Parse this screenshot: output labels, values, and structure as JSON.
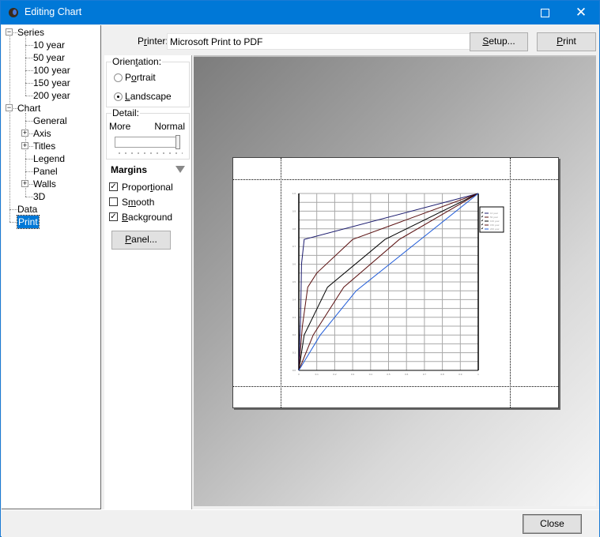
{
  "window": {
    "title": "Editing Chart",
    "minimize_icon": "minimize-icon",
    "maximize_icon": "maximize-icon",
    "close_icon": "close-icon"
  },
  "tree": {
    "expand_glyph": "+",
    "collapse_glyph": "−",
    "nodes": [
      {
        "label": "Series",
        "level": 0,
        "expander": "collapse"
      },
      {
        "label": "10 year",
        "level": 1
      },
      {
        "label": "50 year",
        "level": 1
      },
      {
        "label": "100 year",
        "level": 1
      },
      {
        "label": "150 year",
        "level": 1
      },
      {
        "label": "200 year",
        "level": 1
      },
      {
        "label": "Chart",
        "level": 0,
        "expander": "collapse"
      },
      {
        "label": "General",
        "level": 1
      },
      {
        "label": "Axis",
        "level": 1,
        "expander": "expand"
      },
      {
        "label": "Titles",
        "level": 1,
        "expander": "expand"
      },
      {
        "label": "Legend",
        "level": 1
      },
      {
        "label": "Panel",
        "level": 1
      },
      {
        "label": "Walls",
        "level": 1,
        "expander": "expand"
      },
      {
        "label": "3D",
        "level": 1
      },
      {
        "label": "Data",
        "level": 0
      },
      {
        "label": "Print",
        "level": 0,
        "selected": true
      }
    ]
  },
  "printer": {
    "label_pre": "P",
    "label_ul": "r",
    "label_post": "inter:",
    "value": "Microsoft Print to PDF",
    "setup_ul": "S",
    "setup_rest": "etup...",
    "print_ul": "P",
    "print_rest": "rint"
  },
  "orientation": {
    "label_pre": "Orien",
    "label_ul": "t",
    "label_post": "ation:",
    "portrait_pre": "P",
    "portrait_ul": "o",
    "portrait_post": "rtrait",
    "landscape_ul": "L",
    "landscape_post": "andscape",
    "selected": "Landscape"
  },
  "detail": {
    "label": "Detail:",
    "more_label": "More",
    "normal_label": "Normal",
    "slider_value": 1.0
  },
  "margins": {
    "label": "Margins",
    "proportional_pre": "Propor",
    "proportional_ul": "t",
    "proportional_post": "ional",
    "proportional_checked": true,
    "smooth_pre": "S",
    "smooth_ul": "m",
    "smooth_post": "ooth",
    "smooth_checked": false,
    "background_ul": "B",
    "background_post": "ackground",
    "background_checked": true,
    "panel_ul": "P",
    "panel_rest": "anel...",
    "check_glyph": "✓"
  },
  "footer": {
    "close_label": "Close"
  },
  "chart_data": {
    "type": "line",
    "title": "",
    "xlabel": "",
    "ylabel": "",
    "xlim": [
      0,
      1
    ],
    "ylim": [
      0,
      1
    ],
    "x_ticks": [
      0,
      0.1,
      0.2,
      0.3,
      0.4,
      0.5,
      0.6,
      0.7,
      0.8,
      0.9,
      1
    ],
    "y_gridlines": 20,
    "grid": true,
    "legend_position": "right",
    "legend_title": "",
    "series": [
      {
        "name": "10 year",
        "color": "#1b1b6e",
        "points": [
          [
            0,
            0
          ],
          [
            0.01,
            0.3
          ],
          [
            0.015,
            0.6
          ],
          [
            0.03,
            0.74
          ],
          [
            1,
            1
          ]
        ]
      },
      {
        "name": "50 year",
        "color": "#5a1010",
        "points": [
          [
            0,
            0
          ],
          [
            0.02,
            0.25
          ],
          [
            0.05,
            0.47
          ],
          [
            0.1,
            0.55
          ],
          [
            0.3,
            0.74
          ],
          [
            1,
            1
          ]
        ]
      },
      {
        "name": "100 year",
        "color": "#000000",
        "points": [
          [
            0,
            0
          ],
          [
            0.03,
            0.2
          ],
          [
            0.16,
            0.47
          ],
          [
            0.48,
            0.74
          ],
          [
            1,
            1
          ]
        ]
      },
      {
        "name": "150 year",
        "color": "#5a1010",
        "points": [
          [
            0,
            0
          ],
          [
            0.08,
            0.2
          ],
          [
            0.25,
            0.47
          ],
          [
            0.56,
            0.74
          ],
          [
            1,
            1
          ]
        ]
      },
      {
        "name": "200 year",
        "color": "#1e5ad8",
        "points": [
          [
            0,
            0
          ],
          [
            0.12,
            0.2
          ],
          [
            0.32,
            0.45
          ],
          [
            1,
            1
          ]
        ]
      }
    ]
  }
}
